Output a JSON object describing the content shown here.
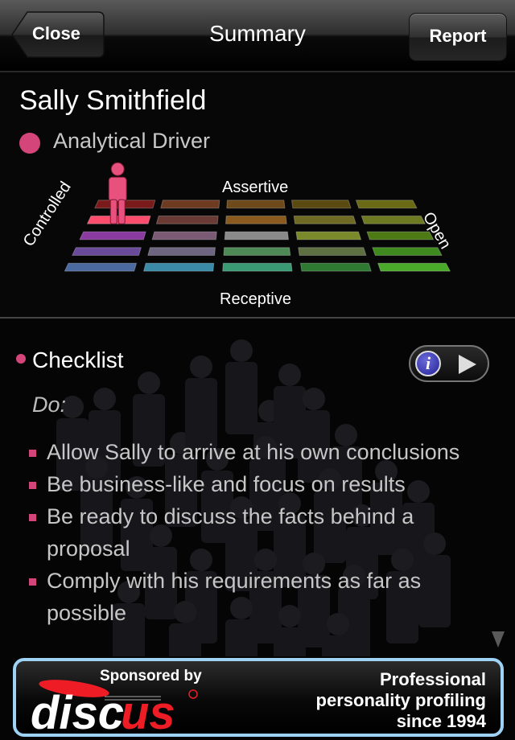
{
  "navbar": {
    "title": "Summary",
    "close_label": "Close",
    "report_label": "Report"
  },
  "profile": {
    "name": "Sally Smithfield",
    "style_label": "Analytical Driver",
    "style_color": "#d4457a",
    "grid": {
      "axes": {
        "top": "Assertive",
        "bottom": "Receptive",
        "left": "Controlled",
        "right": "Open"
      },
      "rows": 5,
      "cols": 5,
      "marker_position": {
        "row": 2,
        "col": 1
      },
      "marker_icon": "person-figure-icon",
      "tile_colors": [
        [
          "#7a1a1a",
          "#6e3a22",
          "#6e4a1a",
          "#5a4a10",
          "#6a6a14"
        ],
        [
          "#ff4d6e",
          "#6a3a34",
          "#8a5a1e",
          "#6e6a24",
          "#6e7a22"
        ],
        [
          "#8a3aa0",
          "#7a5a74",
          "#8a8a8a",
          "#7a8a2a",
          "#4e7a16"
        ],
        [
          "#6a4a9a",
          "#6e6680",
          "#4e8a56",
          "#5e7042",
          "#3e8a1e"
        ],
        [
          "#4a6aa0",
          "#3a8aa8",
          "#3a9a74",
          "#2e7a32",
          "#4aaa2a"
        ]
      ]
    }
  },
  "checklist": {
    "title": "Checklist",
    "subtitle": "Do:",
    "info_icon": "info-icon",
    "play_icon": "play-icon",
    "items": [
      "Allow Sally to arrive at his own conclusions",
      "Be business-like and focus on results",
      "Be ready to discuss the facts behind a proposal",
      "Comply with his requirements as far as possible"
    ]
  },
  "banner": {
    "sponsored_label": "Sponsored by",
    "logo_text_white": "disc",
    "logo_text_red": "us",
    "tagline_lines": [
      "Professional",
      "personality profiling",
      "since 1994"
    ],
    "border_color": "#9fd3f5",
    "accent_color": "#ee1c25"
  }
}
